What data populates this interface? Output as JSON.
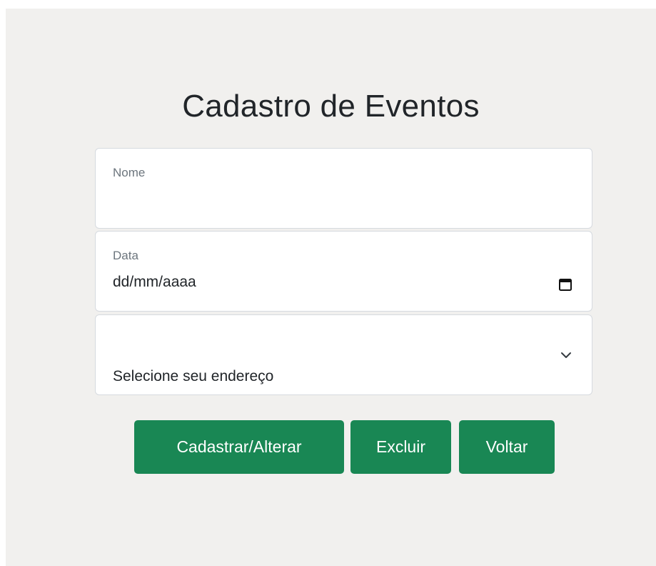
{
  "page": {
    "title": "Cadastro de Eventos"
  },
  "form": {
    "nome": {
      "label": "Nome",
      "value": ""
    },
    "data": {
      "label": "Data",
      "placeholder": "dd/mm/aaaa",
      "icon": "calendar-icon"
    },
    "endereco": {
      "selected": "Selecione seu endereço",
      "icon": "chevron-down-icon"
    }
  },
  "buttons": {
    "submit_label": "Cadastrar/Alterar",
    "delete_label": "Excluir",
    "back_label": "Voltar"
  },
  "colors": {
    "background": "#f1f0ee",
    "button": "#198754",
    "button_text": "#ffffff",
    "field_border": "#d6dadf",
    "label_text": "#6c757d",
    "body_text": "#212529"
  }
}
